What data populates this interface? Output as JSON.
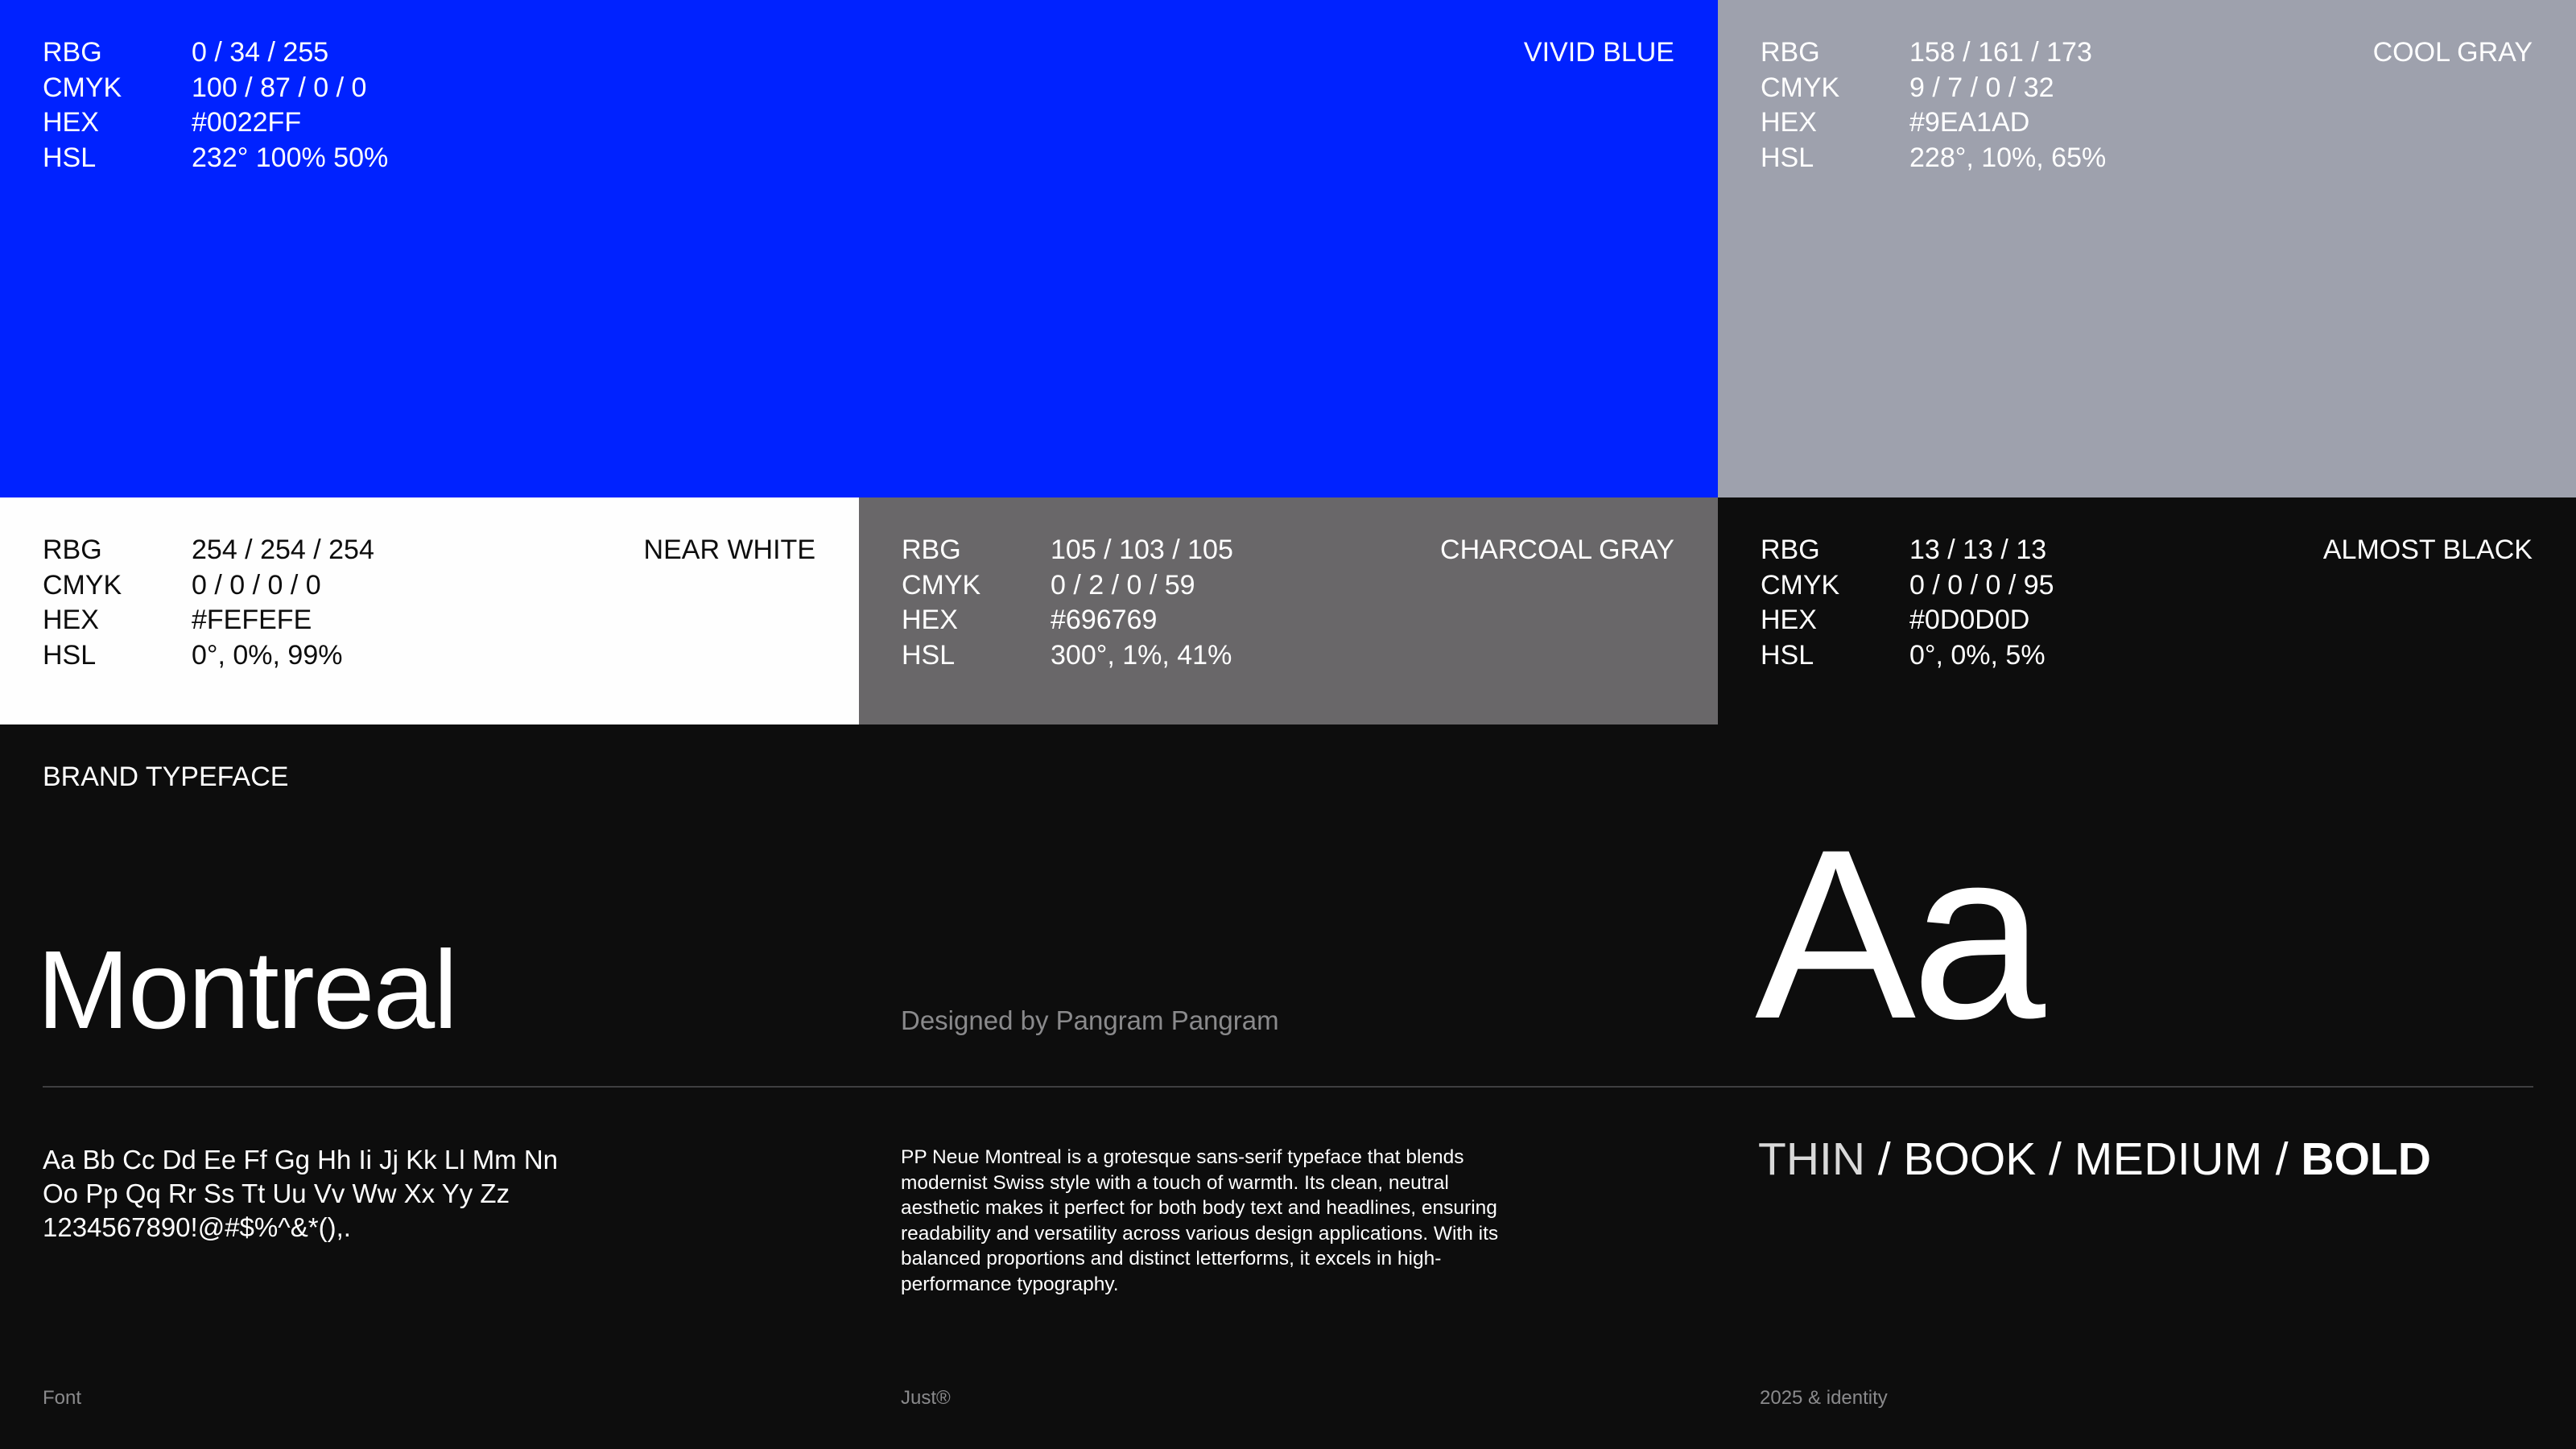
{
  "swatches": {
    "vivid_blue": {
      "name": "VIVID BLUE",
      "color": "#0022FF",
      "rows": [
        {
          "label": "RBG",
          "value": "0 / 34 / 255"
        },
        {
          "label": "CMYK",
          "value": "100 / 87 / 0 / 0"
        },
        {
          "label": "HEX",
          "value": "#0022FF"
        },
        {
          "label": "HSL",
          "value": "232° 100% 50%"
        }
      ]
    },
    "cool_gray": {
      "name": "COOL GRAY",
      "color": "#9EA1AD",
      "rows": [
        {
          "label": "RBG",
          "value": "158 / 161 / 173"
        },
        {
          "label": "CMYK",
          "value": "9 / 7 / 0 / 32"
        },
        {
          "label": "HEX",
          "value": "#9EA1AD"
        },
        {
          "label": "HSL",
          "value": "228°, 10%, 65%"
        }
      ]
    },
    "near_white": {
      "name": "NEAR WHITE",
      "color": "#FEFEFE",
      "rows": [
        {
          "label": "RBG",
          "value": "254 / 254 / 254"
        },
        {
          "label": "CMYK",
          "value": "0 / 0 / 0 / 0"
        },
        {
          "label": "HEX",
          "value": "#FEFEFE"
        },
        {
          "label": "HSL",
          "value": "0°, 0%, 99%"
        }
      ]
    },
    "charcoal_gray": {
      "name": "CHARCOAL GRAY",
      "color": "#696769",
      "rows": [
        {
          "label": "RBG",
          "value": "105 / 103 / 105"
        },
        {
          "label": "CMYK",
          "value": "0 / 2 / 0 / 59"
        },
        {
          "label": "HEX",
          "value": "#696769"
        },
        {
          "label": "HSL",
          "value": "300°, 1%, 41%"
        }
      ]
    },
    "almost_black": {
      "name": "ALMOST BLACK",
      "color": "#0D0D0D",
      "rows": [
        {
          "label": "RBG",
          "value": "13 / 13 / 13"
        },
        {
          "label": "CMYK",
          "value": "0 / 0 / 0 / 95"
        },
        {
          "label": "HEX",
          "value": "#0D0D0D"
        },
        {
          "label": "HSL",
          "value": "0°, 0%, 5%"
        }
      ]
    }
  },
  "typeface": {
    "section_label": "BRAND TYPEFACE",
    "name": "Montreal",
    "designer": "Designed by Pangram Pangram",
    "specimen": "Aa",
    "alphabet_lines": [
      "Aa Bb Cc Dd Ee Ff Gg Hh Ii Jj Kk Ll Mm Nn",
      "Oo Pp Qq Rr Ss Tt Uu Vv Ww Xx Yy Zz",
      "1234567890!@#$%^&*(),."
    ],
    "description": "PP Neue Montreal is a grotesque sans-serif typeface that blends modernist Swiss style with a touch of warmth. Its clean, neutral aesthetic makes it perfect for both body text and headlines, ensuring readability and versatility across various design applications. With its balanced proportions and distinct letterforms, it excels in high-performance typography.",
    "weights": {
      "thin": "THIN",
      "book": "BOOK",
      "medium": "MEDIUM",
      "bold": "BOLD",
      "separator": " / "
    }
  },
  "footer": {
    "left": "Font",
    "center": "Just®",
    "right": "2025 & identity"
  }
}
